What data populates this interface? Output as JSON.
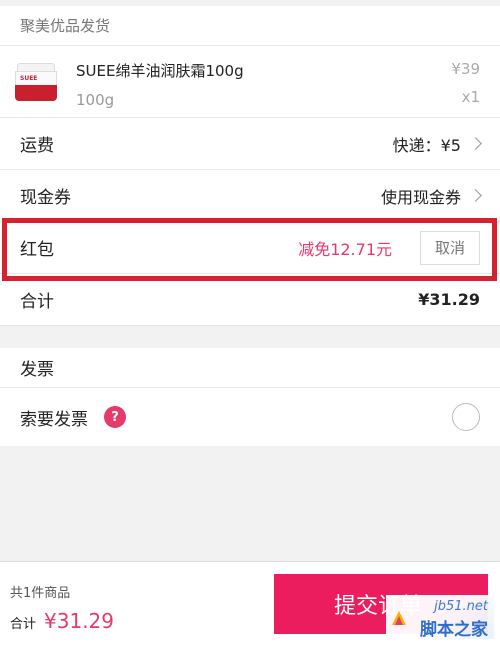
{
  "seller": {
    "name": "聚美优品发货"
  },
  "product": {
    "name": "SUEE绵羊油润肤霜100g",
    "spec": "100g",
    "price": "¥39",
    "quantity": "x1",
    "brand_on_jar": "SUEE"
  },
  "shipping": {
    "label": "运费",
    "value": "快递：¥5"
  },
  "coupon": {
    "label": "现金券",
    "value": "使用现金券"
  },
  "red_packet": {
    "label": "红包",
    "discount": "减免12.71元",
    "cancel_label": "取消"
  },
  "total": {
    "label": "合计",
    "value": "¥31.29"
  },
  "invoice": {
    "section_title": "发票",
    "request_label": "索要发票",
    "help_icon_glyph": "?"
  },
  "footer": {
    "item_count": "共1件商品",
    "total_label": "合计",
    "total_value": "¥31.29",
    "submit_label": "提交订单"
  },
  "watermark": {
    "url": "jb51.net",
    "text": "脚本之家"
  },
  "colors": {
    "accent": "#ec1d5e",
    "discount": "#e8396b",
    "highlight": "#d4232f"
  }
}
